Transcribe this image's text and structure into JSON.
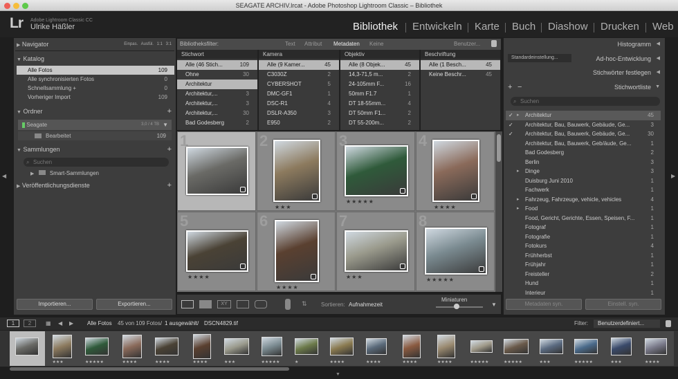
{
  "window": {
    "title": "SEAGATE ARCHIV.lrcat - Adobe Photoshop Lightroom Classic – Bibliothek"
  },
  "identity": {
    "logo": "Lr",
    "product": "Adobe Lightroom Classic CC",
    "user": "Ulrike Häßler"
  },
  "modules": [
    "Bibliothek",
    "Entwickeln",
    "Karte",
    "Buch",
    "Diashow",
    "Drucken",
    "Web"
  ],
  "left": {
    "navigator": {
      "label": "Navigator",
      "opts": [
        "Einpas.",
        "Ausfül.",
        "1:1",
        "3:1"
      ]
    },
    "catalog": {
      "label": "Katalog",
      "items": [
        {
          "label": "Alle Fotos",
          "count": "109"
        },
        {
          "label": "Alle synchronisierten Fotos",
          "count": "0"
        },
        {
          "label": "Schnellsammlung +",
          "count": "0"
        },
        {
          "label": "Vorheriger Import",
          "count": "109"
        }
      ]
    },
    "folders": {
      "label": "Ordner",
      "volume": "Seagate",
      "volume_info": "3,0 / 4 TB",
      "folder": "Bearbeitet",
      "folder_count": "109"
    },
    "collections": {
      "label": "Sammlungen",
      "search": "Suchen",
      "smart": "Smart-Sammlungen"
    },
    "publish": {
      "label": "Veröffentlichungsdienste"
    },
    "import": "Importieren...",
    "export": "Exportieren..."
  },
  "filter": {
    "label": "Bibliotheksfilter:",
    "tabs": [
      "Text",
      "Attribut",
      "Metadaten",
      "Keine"
    ],
    "preset": "Benutzer...",
    "columns": [
      {
        "head": "Stichwort",
        "rows": [
          [
            "Alle (46 Stich...",
            "109"
          ],
          [
            "Ohne",
            "30"
          ],
          [
            "Architektur",
            ""
          ],
          [
            "Architektur,...",
            "3"
          ],
          [
            "Architektur,...",
            "3"
          ],
          [
            "Architektur,...",
            "30"
          ],
          [
            "Bad Godesberg",
            "2"
          ]
        ]
      },
      {
        "head": "Kamera",
        "rows": [
          [
            "Alle (9 Kamer...",
            "45"
          ],
          [
            "C3030Z",
            "2"
          ],
          [
            "CYBERSHOT",
            "5"
          ],
          [
            "DMC-GF1",
            "1"
          ],
          [
            "DSC-R1",
            "4"
          ],
          [
            "DSLR-A350",
            "3"
          ],
          [
            "E950",
            "2"
          ]
        ]
      },
      {
        "head": "Objektiv",
        "rows": [
          [
            "Alle (8 Objek...",
            "45"
          ],
          [
            "14,3-71,5 m...",
            "2"
          ],
          [
            "24-105mm F...",
            "16"
          ],
          [
            "50mm F1.7",
            "1"
          ],
          [
            "DT 18-55mm...",
            "4"
          ],
          [
            "DT 50mm F1...",
            "2"
          ],
          [
            "DT 55-200m...",
            "2"
          ]
        ]
      },
      {
        "head": "Beschriftung",
        "rows": [
          [
            "Alle (1 Besch...",
            "45"
          ],
          [
            "Keine Beschr...",
            "45"
          ]
        ]
      }
    ]
  },
  "grid": {
    "cells": [
      {
        "num": "1",
        "stars": ""
      },
      {
        "num": "2",
        "stars": "★★★"
      },
      {
        "num": "3",
        "stars": "★★★★★"
      },
      {
        "num": "4",
        "stars": "★★★★"
      },
      {
        "num": "5",
        "stars": "★★★★"
      },
      {
        "num": "6",
        "stars": "★★★★"
      },
      {
        "num": "7",
        "stars": "★★★"
      },
      {
        "num": "8",
        "stars": "★★★★★"
      }
    ]
  },
  "toolbar": {
    "sort_label": "Sortieren:",
    "sort_value": "Aufnahmezeit",
    "thumb_label": "Miniaturen"
  },
  "right": {
    "histogram": "Histogramm",
    "preset": "Standardeinstellung...",
    "quick_dev": "Ad-hoc-Entwicklung",
    "kw_set": "Stichwörter festlegen",
    "kw_list": "Stichwortliste",
    "search": "Suchen",
    "keywords": [
      {
        "label": "Architektur",
        "count": "45",
        "chk": "✓",
        "exp": "▸"
      },
      {
        "label": "Architektur, Bau, Bauwerk, Gebäude, Ge...",
        "count": "3",
        "chk": "✓",
        "exp": ""
      },
      {
        "label": "Architektur, Bau, Bauwerk, Gebäude, Ge...",
        "count": "30",
        "chk": "✓",
        "exp": ""
      },
      {
        "label": "Architektur, Bau, Bauwerk, Geb/äude, Ge...",
        "count": "1",
        "chk": "",
        "exp": ""
      },
      {
        "label": "Bad Godesberg",
        "count": "2",
        "chk": "",
        "exp": ""
      },
      {
        "label": "Berlin",
        "count": "3",
        "chk": "",
        "exp": ""
      },
      {
        "label": "Dinge",
        "count": "3",
        "chk": "",
        "exp": "▸"
      },
      {
        "label": "Duisburg Juni 2010",
        "count": "1",
        "chk": "",
        "exp": ""
      },
      {
        "label": "Fachwerk",
        "count": "1",
        "chk": "",
        "exp": ""
      },
      {
        "label": "Fahrzeug, Fahrzeuge, vehicle, vehicles",
        "count": "4",
        "chk": "",
        "exp": "▸"
      },
      {
        "label": "Food",
        "count": "1",
        "chk": "",
        "exp": "▸"
      },
      {
        "label": "Food, Gericht, Gerichte, Essen, Speisen, F...",
        "count": "1",
        "chk": "",
        "exp": ""
      },
      {
        "label": "Fotograf",
        "count": "1",
        "chk": "",
        "exp": ""
      },
      {
        "label": "Fotografie",
        "count": "1",
        "chk": "",
        "exp": ""
      },
      {
        "label": "Fotokurs",
        "count": "4",
        "chk": "",
        "exp": ""
      },
      {
        "label": "Frühherbst",
        "count": "1",
        "chk": "",
        "exp": ""
      },
      {
        "label": "Frühjahr",
        "count": "1",
        "chk": "",
        "exp": ""
      },
      {
        "label": "Freisteller",
        "count": "2",
        "chk": "",
        "exp": ""
      },
      {
        "label": "Hund",
        "count": "1",
        "chk": "",
        "exp": ""
      },
      {
        "label": "Interieur",
        "count": "1",
        "chk": "",
        "exp": ""
      }
    ],
    "sync_meta": "Metadaten syn.",
    "sync_settings": "Einstell. syn."
  },
  "filmstrip": {
    "view1": "1",
    "view2": "2",
    "source": "Alle Fotos",
    "info": "45 von 109 Fotos/",
    "selected": "1 ausgewählt/",
    "file": "DSCN4829.tif",
    "filter_label": "Filter:",
    "filter_value": "Benutzerdefiniert...",
    "stars": [
      "",
      "★★★",
      "★★★★★",
      "★★★★",
      "★★★★",
      "★★★★",
      "★★★",
      "★★★★★",
      "★",
      "★★★★",
      "★★★★",
      "★★★★",
      "★★★★",
      "★★★★★",
      "★★★★★",
      "★★★",
      "★★★★★",
      "★★★",
      "★★★★"
    ]
  }
}
